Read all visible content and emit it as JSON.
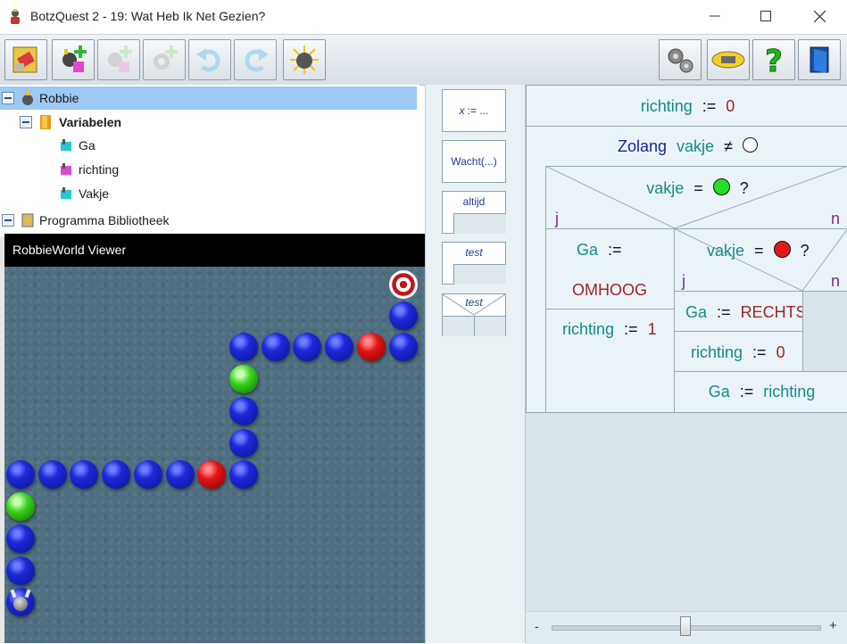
{
  "window": {
    "title": "BotzQuest 2 - 19: Wat Heb Ik Net Gezien?",
    "controls": [
      "minimize",
      "maximize",
      "close"
    ]
  },
  "toolbar": {
    "buttons": [
      {
        "icon": "new-program-icon"
      },
      {
        "icon": "add-robot-icon"
      },
      {
        "icon": "add-robot-disabled-icon"
      },
      {
        "icon": "add-gear-disabled-icon"
      },
      {
        "icon": "undo-icon"
      },
      {
        "icon": "redo-icon"
      },
      {
        "icon": "run-robot-icon"
      }
    ],
    "right_buttons": [
      {
        "icon": "settings-gears-icon"
      },
      {
        "icon": "badge-icon"
      },
      {
        "icon": "help-icon"
      },
      {
        "icon": "exit-door-icon"
      }
    ]
  },
  "tree": {
    "robot": "Robbie",
    "variables_folder": "Variabelen",
    "variables": [
      "Ga",
      "richting",
      "Vakje"
    ],
    "library": "Programma Bibliotheek"
  },
  "viewer": {
    "title": "RobbieWorld Viewer"
  },
  "palette": {
    "assign_x": "x",
    "assign_rest": ":= ...",
    "wait": "Wacht(...)",
    "forever": "altijd",
    "test1": "test",
    "test2": "test"
  },
  "nsd": {
    "line1": {
      "var": "richting",
      "op": ":=",
      "val": "0"
    },
    "while": {
      "kw": "Zolang",
      "var": "vakje",
      "op": "≠"
    },
    "if1": {
      "var": "vakje",
      "op": "=",
      "q": "?",
      "yes": "j",
      "no": "n"
    },
    "then1": {
      "var": "Ga",
      "op": ":=",
      "val": "OMHOOG"
    },
    "then2": {
      "var": "richting",
      "op": ":=",
      "val": "1"
    },
    "if2": {
      "var": "vakje",
      "op": "=",
      "q": "?",
      "yes": "j",
      "no": "n"
    },
    "then3": {
      "var": "Ga",
      "op": ":=",
      "val": "RECHTS"
    },
    "then4": {
      "var": "richting",
      "op": ":=",
      "val": "0"
    },
    "last": {
      "var": "Ga",
      "op": ":=",
      "val": "richting"
    }
  },
  "zoom": {
    "minus": "-",
    "plus": "+",
    "value": 0.5
  }
}
